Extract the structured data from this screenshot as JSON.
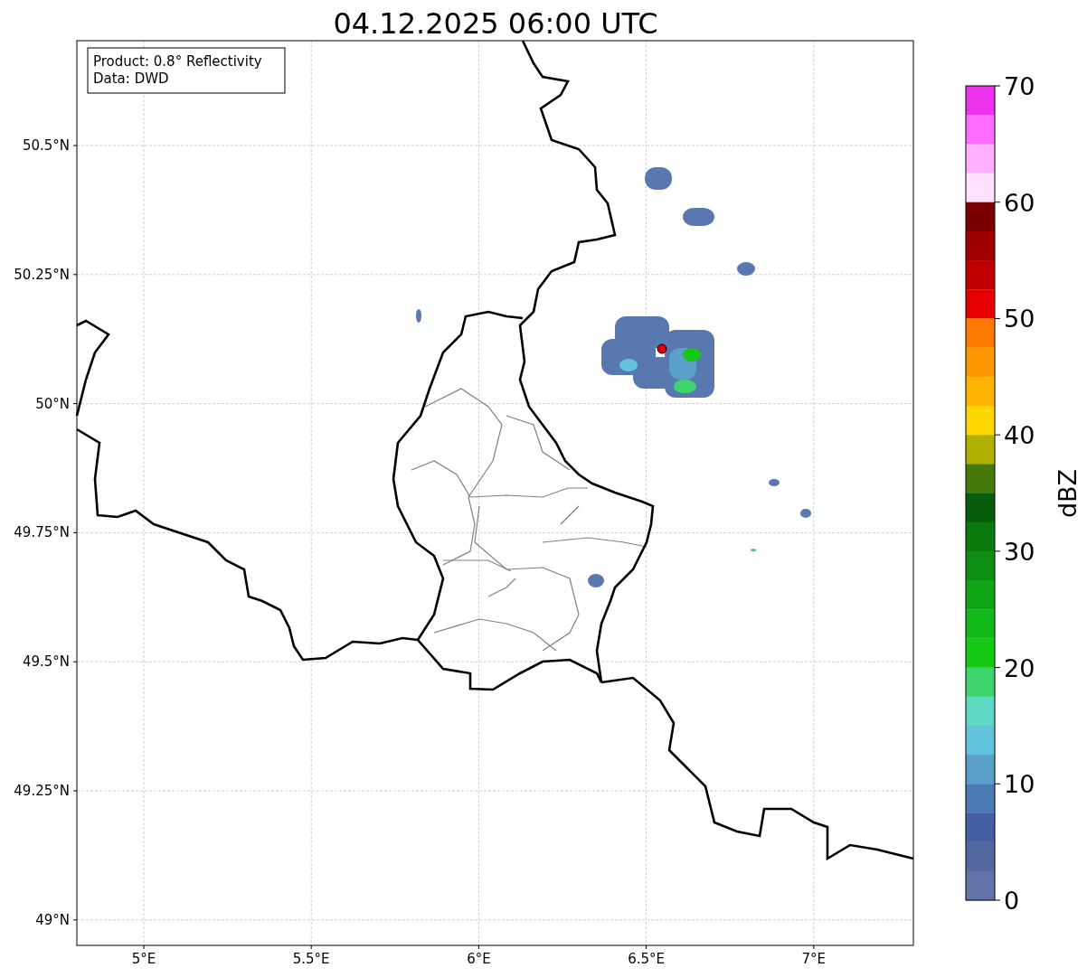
{
  "title": "04.12.2025 06:00 UTC",
  "info_box": {
    "lines": [
      "Product: 0.8° Reflectivity",
      "Data: DWD"
    ]
  },
  "map": {
    "x_ticks": [
      "5°E",
      "5.5°E",
      "6°E",
      "6.5°E",
      "7°E"
    ],
    "y_ticks": [
      "50.5°N",
      "50.25°N",
      "50°N",
      "49.75°N",
      "49.5°N",
      "49.25°N",
      "49°N"
    ]
  },
  "colorbar": {
    "label": "dBZ",
    "ticks": [
      "70",
      "60",
      "50",
      "40",
      "30",
      "20",
      "10",
      "0"
    ],
    "bins": [
      {
        "color": "#ec32ec"
      },
      {
        "color": "#ff6cff"
      },
      {
        "color": "#ffb0ff"
      },
      {
        "color": "#ffe0ff"
      },
      {
        "color": "#780000"
      },
      {
        "color": "#a00000"
      },
      {
        "color": "#c00000"
      },
      {
        "color": "#e60000"
      },
      {
        "color": "#ff7a00"
      },
      {
        "color": "#ff9600"
      },
      {
        "color": "#ffb400"
      },
      {
        "color": "#ffd700"
      },
      {
        "color": "#b0b000"
      },
      {
        "color": "#457a0a"
      },
      {
        "color": "#065c0a"
      },
      {
        "color": "#0b7a0f"
      },
      {
        "color": "#0d8d12"
      },
      {
        "color": "#0fa514"
      },
      {
        "color": "#10b818"
      },
      {
        "color": "#14c814"
      },
      {
        "color": "#3ed46e"
      },
      {
        "color": "#5ed8c3"
      },
      {
        "color": "#64c3dc"
      },
      {
        "color": "#5aa0c8"
      },
      {
        "color": "#4a7bb3"
      },
      {
        "color": "#4560a2"
      },
      {
        "color": "#5468a0"
      },
      {
        "color": "#6574a8"
      }
    ]
  }
}
